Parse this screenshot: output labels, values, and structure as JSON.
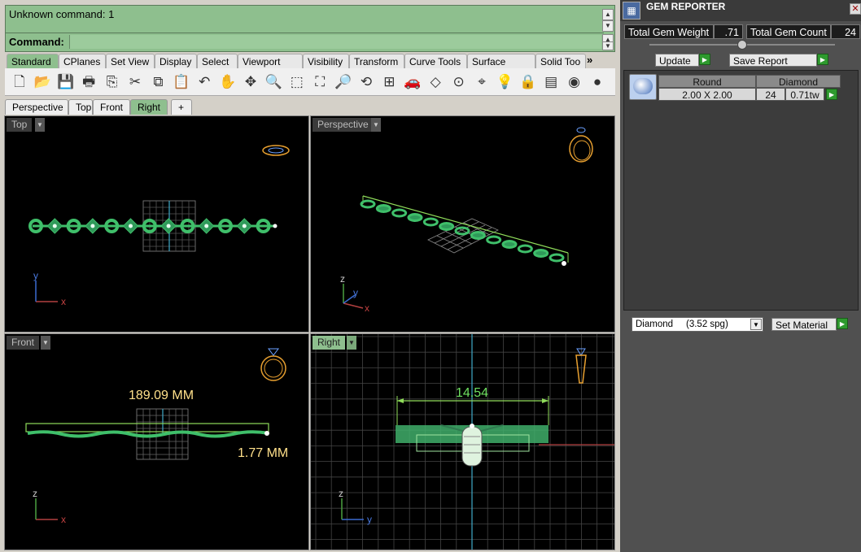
{
  "command": {
    "history": "Unknown command: 1",
    "label": "Command:",
    "value": ""
  },
  "toolbar_tabs": [
    "Standard",
    "CPlanes",
    "Set View",
    "Display",
    "Select",
    "Viewport Layout",
    "Visibility",
    "Transform",
    "Curve Tools",
    "Surface Tools",
    "Solid Too"
  ],
  "toolbar_more": "»",
  "toolbar_icons": [
    {
      "name": "new-file-icon",
      "glyph": "🗋"
    },
    {
      "name": "open-folder-icon",
      "glyph": "📂"
    },
    {
      "name": "save-icon",
      "glyph": "💾"
    },
    {
      "name": "print-icon",
      "glyph": "🖶"
    },
    {
      "name": "export-icon",
      "glyph": "⎘"
    },
    {
      "name": "cut-icon",
      "glyph": "✂"
    },
    {
      "name": "copy-icon",
      "glyph": "⧉"
    },
    {
      "name": "paste-icon",
      "glyph": "📋"
    },
    {
      "name": "undo-icon",
      "glyph": "↶"
    },
    {
      "name": "pan-hand-icon",
      "glyph": "✋"
    },
    {
      "name": "rotate-view-icon",
      "glyph": "✥"
    },
    {
      "name": "zoom-icon",
      "glyph": "🔍"
    },
    {
      "name": "zoom-window-icon",
      "glyph": "⬚"
    },
    {
      "name": "zoom-extents-icon",
      "glyph": "⛶"
    },
    {
      "name": "zoom-selected-icon",
      "glyph": "🔎"
    },
    {
      "name": "undo-view-icon",
      "glyph": "⟲"
    },
    {
      "name": "four-views-icon",
      "glyph": "⊞"
    },
    {
      "name": "car-object-icon",
      "glyph": "🚗"
    },
    {
      "name": "cplane-icon",
      "glyph": "◇"
    },
    {
      "name": "point-icon",
      "glyph": "⊙"
    },
    {
      "name": "osnap-icon",
      "glyph": "⌖"
    },
    {
      "name": "light-bulb-icon",
      "glyph": "💡"
    },
    {
      "name": "lock-icon",
      "glyph": "🔒"
    },
    {
      "name": "layer-icon",
      "glyph": "▤"
    },
    {
      "name": "color-wheel-icon",
      "glyph": "◉"
    },
    {
      "name": "render-sphere-icon",
      "glyph": "●"
    }
  ],
  "view_tabs": [
    "Perspective",
    "Top",
    "Front",
    "Right"
  ],
  "view_tab_add": "+",
  "viewports": {
    "top": {
      "label": "Top"
    },
    "perspective": {
      "label": "Perspective"
    },
    "front": {
      "label": "Front",
      "length_dim": "189.09 MM",
      "thickness_dim": "1.77 MM"
    },
    "right": {
      "label": "Right",
      "width_dim": "14.54"
    }
  },
  "axes": {
    "x": "x",
    "y": "y",
    "z": "z"
  },
  "gem_reporter": {
    "title": "GEM REPORTER",
    "total_weight_label": "Total Gem Weight",
    "total_weight": ".71",
    "total_count_label": "Total Gem Count",
    "total_count": "24",
    "update_label": "Update",
    "save_report_label": "Save Report",
    "table": {
      "headers": [
        "Round",
        "Diamond"
      ],
      "row": {
        "size": "2.00 X 2.00",
        "count": "24",
        "weight": "0.71tw"
      }
    },
    "material_select": "Diamond     (3.52 spg)",
    "set_material_label": "Set Material"
  },
  "colors": {
    "command_green": "#8ebf8e",
    "model_green": "#3fbf6a",
    "dimension_yellow": "#ffe08a",
    "grid_gray": "#777777",
    "panel_dark": "#505050"
  }
}
